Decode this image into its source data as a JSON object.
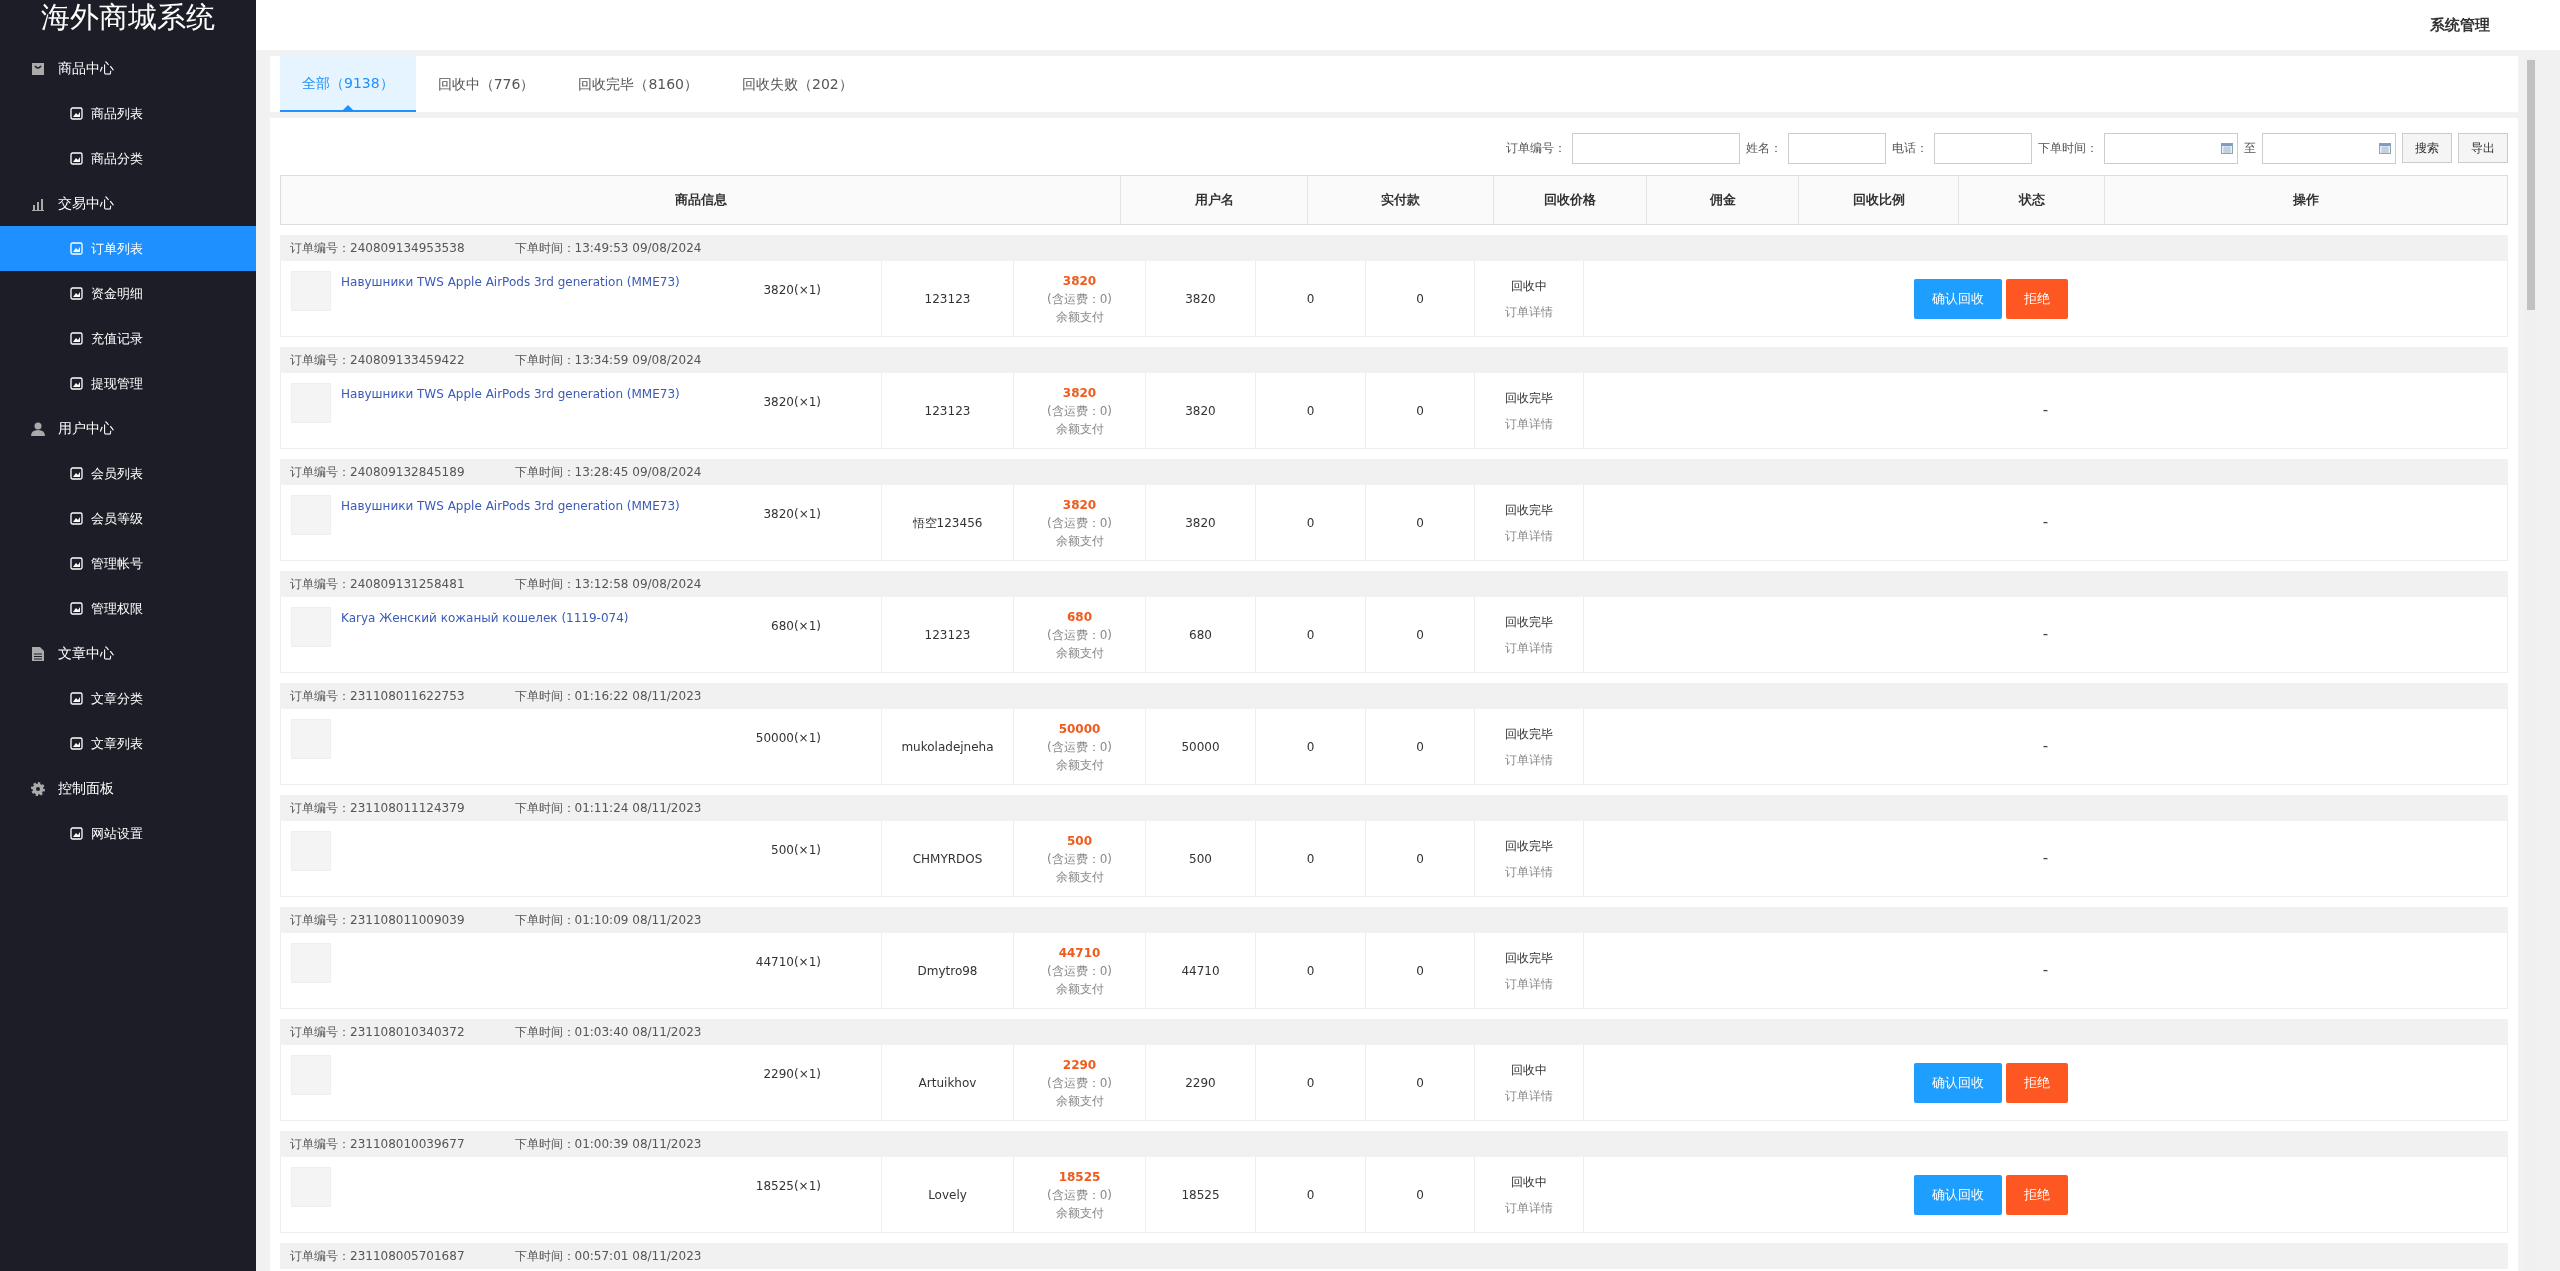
{
  "sidebar": {
    "title": "海外商城系统",
    "groups": [
      {
        "label": "商品中心",
        "items": [
          {
            "label": "商品列表",
            "selected": false
          },
          {
            "label": "商品分类",
            "selected": false
          }
        ]
      },
      {
        "label": "交易中心",
        "items": [
          {
            "label": "订单列表",
            "selected": true
          },
          {
            "label": "资金明细",
            "selected": false
          },
          {
            "label": "充值记录",
            "selected": false
          },
          {
            "label": "提现管理",
            "selected": false
          }
        ]
      },
      {
        "label": "用户中心",
        "items": [
          {
            "label": "会员列表",
            "selected": false
          },
          {
            "label": "会员等级",
            "selected": false
          },
          {
            "label": "管理帐号",
            "selected": false
          },
          {
            "label": "管理权限",
            "selected": false
          }
        ]
      },
      {
        "label": "文章中心",
        "items": [
          {
            "label": "文章分类",
            "selected": false
          },
          {
            "label": "文章列表",
            "selected": false
          }
        ]
      },
      {
        "label": "控制面板",
        "items": [
          {
            "label": "网站设置",
            "selected": false
          }
        ]
      }
    ]
  },
  "topbar": {
    "user_menu": "系统管理"
  },
  "tabs": [
    {
      "label": "全部（9138）",
      "selected": true
    },
    {
      "label": "回收中（776）",
      "selected": false
    },
    {
      "label": "回收完毕（8160）",
      "selected": false
    },
    {
      "label": "回收失败（202）",
      "selected": false
    }
  ],
  "filters": [
    {
      "kind": "text",
      "label": "订单编号："
    },
    {
      "kind": "text",
      "label": "姓名："
    },
    {
      "kind": "text",
      "label": "电话："
    },
    {
      "kind": "date",
      "label": "下单时间："
    },
    {
      "kind": "date",
      "label": "至"
    }
  ],
  "filter_buttons": [
    "搜索",
    "导出"
  ],
  "table": {
    "columns": [
      "商品信息",
      "用户名",
      "实付款",
      "回收价格",
      "佣金",
      "回收比例",
      "状态",
      "操作"
    ],
    "orders": [
      {
        "order_no": "订单编号：240809134953538",
        "time": "下单时间：13:49:53 09/08/2024",
        "product": "Навушники TWS Apple AirPods 3rd generation (MME73)",
        "price_qty": "3820(×1)",
        "user": "123123",
        "paid": "3820",
        "shipping": "(含运费：0)",
        "pay_method": "余额支付",
        "recycle_price": "3820",
        "commission": "0",
        "ratio": "0",
        "status": "回收中",
        "detail": "订单详情",
        "actions": [
          {
            "kind": "confirm",
            "label": "确认回收"
          },
          {
            "kind": "reject",
            "label": "拒绝"
          }
        ]
      },
      {
        "order_no": "订单编号：240809133459422",
        "time": "下单时间：13:34:59 09/08/2024",
        "product": "Навушники TWS Apple AirPods 3rd generation (MME73)",
        "price_qty": "3820(×1)",
        "user": "123123",
        "paid": "3820",
        "shipping": "(含运费：0)",
        "pay_method": "余额支付",
        "recycle_price": "3820",
        "commission": "0",
        "ratio": "0",
        "status": "回收完毕",
        "detail": "订单详情",
        "operation": "-"
      },
      {
        "order_no": "订单编号：240809132845189",
        "time": "下单时间：13:28:45 09/08/2024",
        "product": "Навушники TWS Apple AirPods 3rd generation (MME73)",
        "price_qty": "3820(×1)",
        "user": "悟空123456",
        "paid": "3820",
        "shipping": "(含运费：0)",
        "pay_method": "余额支付",
        "recycle_price": "3820",
        "commission": "0",
        "ratio": "0",
        "status": "回收完毕",
        "detail": "订单详情",
        "operation": "-"
      },
      {
        "order_no": "订单编号：240809131258481",
        "time": "下单时间：13:12:58 09/08/2024",
        "product": "Karya Женский кожаный кошелек (1119-074)",
        "price_qty": "680(×1)",
        "user": "123123",
        "paid": "680",
        "shipping": "(含运费：0)",
        "pay_method": "余额支付",
        "recycle_price": "680",
        "commission": "0",
        "ratio": "0",
        "status": "回收完毕",
        "detail": "订单详情",
        "operation": "-"
      },
      {
        "order_no": "订单编号：231108011622753",
        "time": "下单时间：01:16:22 08/11/2023",
        "price_qty": "50000(×1)",
        "user": "mukoladejneha",
        "paid": "50000",
        "shipping": "(含运费：0)",
        "pay_method": "余额支付",
        "recycle_price": "50000",
        "commission": "0",
        "ratio": "0",
        "status": "回收完毕",
        "detail": "订单详情",
        "operation": "-"
      },
      {
        "order_no": "订单编号：231108011124379",
        "time": "下单时间：01:11:24 08/11/2023",
        "price_qty": "500(×1)",
        "user": "CHMYRDOS",
        "paid": "500",
        "shipping": "(含运费：0)",
        "pay_method": "余额支付",
        "recycle_price": "500",
        "commission": "0",
        "ratio": "0",
        "status": "回收完毕",
        "detail": "订单详情",
        "operation": "-"
      },
      {
        "order_no": "订单编号：231108011009039",
        "time": "下单时间：01:10:09 08/11/2023",
        "price_qty": "44710(×1)",
        "user": "Dmytro98",
        "paid": "44710",
        "shipping": "(含运费：0)",
        "pay_method": "余额支付",
        "recycle_price": "44710",
        "commission": "0",
        "ratio": "0",
        "status": "回收完毕",
        "detail": "订单详情",
        "operation": "-"
      },
      {
        "order_no": "订单编号：231108010340372",
        "time": "下单时间：01:03:40 08/11/2023",
        "price_qty": "2290(×1)",
        "user": "Artuikhov",
        "paid": "2290",
        "shipping": "(含运费：0)",
        "pay_method": "余额支付",
        "recycle_price": "2290",
        "commission": "0",
        "ratio": "0",
        "status": "回收中",
        "detail": "订单详情",
        "actions": [
          {
            "kind": "confirm",
            "label": "确认回收"
          },
          {
            "kind": "reject",
            "label": "拒绝"
          }
        ]
      },
      {
        "order_no": "订单编号：231108010039677",
        "time": "下单时间：01:00:39 08/11/2023",
        "price_qty": "18525(×1)",
        "user": "Lovely",
        "paid": "18525",
        "shipping": "(含运费：0)",
        "pay_method": "余额支付",
        "recycle_price": "18525",
        "commission": "0",
        "ratio": "0",
        "status": "回收中",
        "detail": "订单详情",
        "actions": [
          {
            "kind": "confirm",
            "label": "确认回收"
          },
          {
            "kind": "reject",
            "label": "拒绝"
          }
        ]
      },
      {
        "order_no": "订单编号：231108005701687",
        "time": "下单时间：00:57:01 08/11/2023"
      }
    ]
  }
}
